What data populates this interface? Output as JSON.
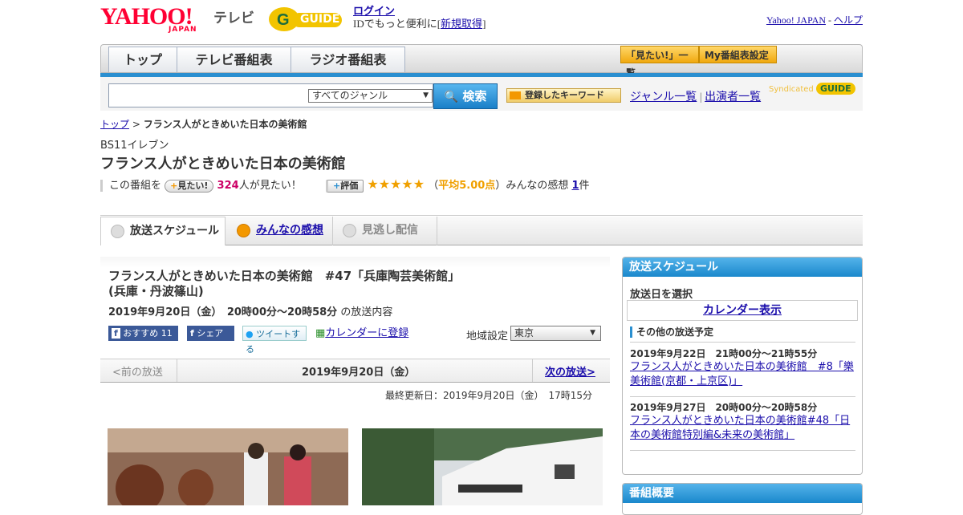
{
  "header": {
    "yahoo_logo": "YAHOO!",
    "yahoo_japan": "JAPAN",
    "tv_label": "テレビ",
    "gguide_logo": "GUIDE",
    "login_link": "ログイン",
    "login_prefix": "IDでもっと便利に[",
    "signup_link": "新規取得",
    "login_suffix": "]",
    "yahoo_japan_link": "Yahoo! JAPAN",
    "separator": " - ",
    "help_link": "ヘルプ"
  },
  "nav": {
    "tabs": [
      "トップ",
      "テレビ番組表",
      "ラジオ番組表"
    ],
    "want_list": "「見たい!」一覧",
    "my_schedule": "My番組表設定"
  },
  "search": {
    "genre_selected": "すべてのジャンル",
    "search_button": "検索",
    "keyword_button": "登録したキーワード",
    "genre_list": "ジャンル一覧",
    "pipe": "|",
    "performer_list": "出演者一覧",
    "syndicated": "Syndicated"
  },
  "breadcrumb": {
    "top": "トップ",
    "sep": " > ",
    "current": "フランス人がときめいた日本の美術館"
  },
  "program": {
    "channel": "BS11イレブン",
    "title": "フランス人がときめいた日本の美術館",
    "want_prefix": "この番組を",
    "want_button": "見たい!",
    "want_count": "324",
    "want_suffix": "人が見たい！",
    "rating_button": "評価",
    "stars": "★★★★★",
    "rating_open": "（",
    "rating_avg": "平均5.00点",
    "rating_close": "）",
    "impressions_label": "みんなの感想",
    "impressions_count": "1",
    "impressions_suffix": "件"
  },
  "subtabs": [
    "放送スケジュール",
    "みんなの感想",
    "見逃し配信"
  ],
  "episode": {
    "title": "フランス人がときめいた日本の美術館　#47「兵庫陶芸美術館」(兵庫・丹波篠山)",
    "datetime": "2019年9月20日（金）　20時00分～20時58分",
    "datetime_suffix": "の放送内容",
    "recommend_label": "おすすめ",
    "recommend_count": "11",
    "share_label": "シェア",
    "tweet_label": "ツイートする",
    "calendar_link": "カレンダーに登録",
    "region_label": "地域設定",
    "region_value": "東京"
  },
  "pager": {
    "prev": "<前の放送",
    "current": "2019年9月20日（金）",
    "next": "次の放送>"
  },
  "updated": "最終更新日：2019年9月20日（金）　17時15分",
  "sidebar": {
    "schedule_head": "放送スケジュール",
    "choose_date": "放送日を選択",
    "calendar_show": "カレンダー表示",
    "other_head": "その他の放送予定",
    "items": [
      {
        "date": "2019年9月22日　21時00分～21時55分",
        "title": "フランス人がときめいた日本の美術館　#8「樂美術館(京都・上京区)」"
      },
      {
        "date": "2019年9月27日　20時00分～20時58分",
        "title": "フランス人がときめいた日本の美術館#48「日本の美術館特別編&未来の美術館」"
      }
    ],
    "summary_head": "番組概要"
  },
  "colors": {
    "accent_blue": "#2a8fd0",
    "brand_red": "#ff0033",
    "star": "#f0a000",
    "want_count": "#cc0066"
  }
}
